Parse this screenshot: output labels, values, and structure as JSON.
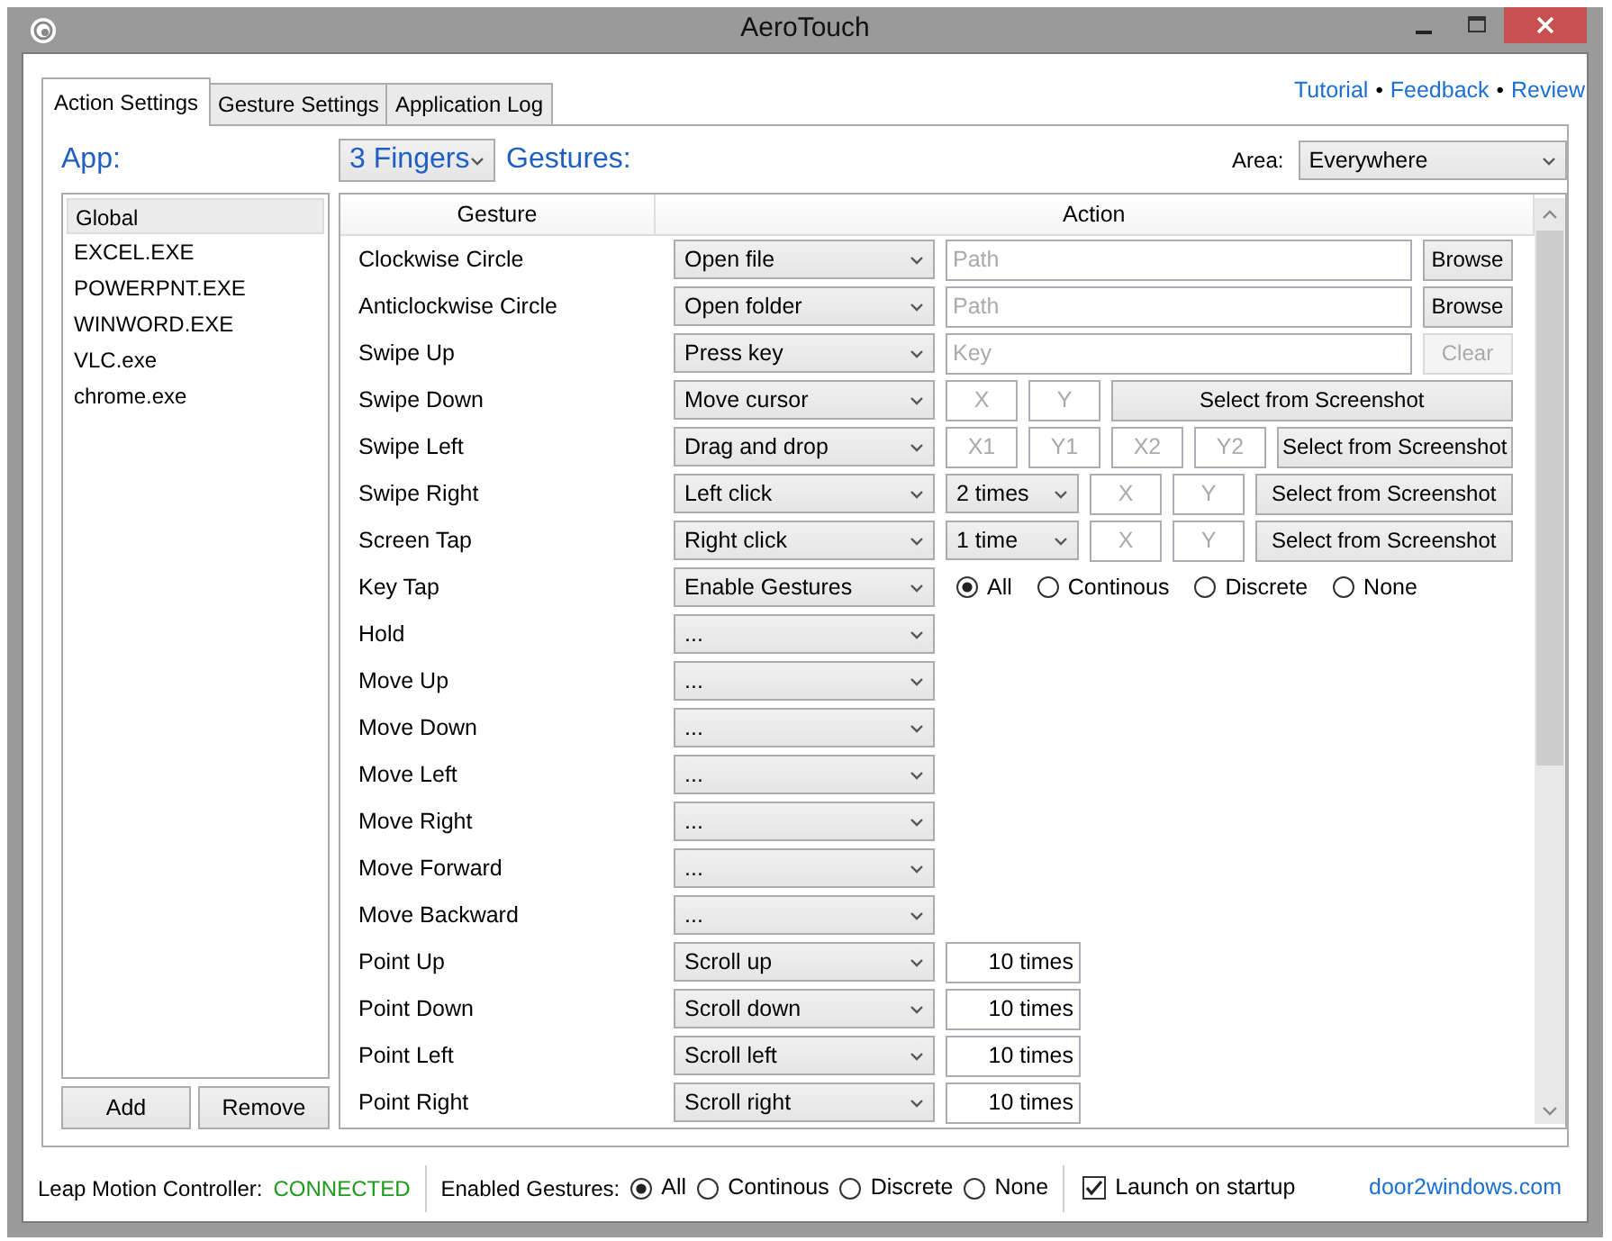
{
  "window": {
    "title": "AeroTouch"
  },
  "tabs": [
    {
      "label": "Action Settings",
      "selected": true
    },
    {
      "label": "Gesture Settings",
      "selected": false
    },
    {
      "label": "Application Log",
      "selected": false
    }
  ],
  "top_links": [
    {
      "kind": "link",
      "text": "Tutorial"
    },
    {
      "kind": "dot",
      "text": "•"
    },
    {
      "kind": "link",
      "text": "Feedback"
    },
    {
      "kind": "dot",
      "text": "•"
    },
    {
      "kind": "link",
      "text": "Review"
    }
  ],
  "app_panel": {
    "label": "App:",
    "apps": [
      {
        "name": "Global",
        "selected": true
      },
      {
        "name": "EXCEL.EXE",
        "selected": false
      },
      {
        "name": "POWERPNT.EXE",
        "selected": false
      },
      {
        "name": "WINWORD.EXE",
        "selected": false
      },
      {
        "name": "VLC.exe",
        "selected": false
      },
      {
        "name": "chrome.exe",
        "selected": false
      }
    ],
    "buttons": [
      "Add",
      "Remove"
    ]
  },
  "fingers": {
    "value": "3 Fingers"
  },
  "gestures_label": "Gestures:",
  "area": {
    "label": "Area:",
    "value": "Everywhere"
  },
  "table": {
    "columns": [
      "Gesture",
      "Action"
    ],
    "rows": [
      {
        "gesture": "Clockwise Circle",
        "action": "Open file",
        "kind": "path",
        "placeholder": "Path",
        "button": {
          "label": "Browse",
          "disabled": false
        }
      },
      {
        "gesture": "Anticlockwise Circle",
        "action": "Open folder",
        "kind": "path",
        "placeholder": "Path",
        "button": {
          "label": "Browse",
          "disabled": false
        }
      },
      {
        "gesture": "Swipe Up",
        "action": "Press key",
        "kind": "path",
        "placeholder": "Key",
        "button": {
          "label": "Clear",
          "disabled": true
        }
      },
      {
        "gesture": "Swipe Down",
        "action": "Move cursor",
        "kind": "point",
        "placeholders": [
          "X",
          "Y"
        ],
        "button": {
          "label": "Select from Screenshot",
          "disabled": false
        }
      },
      {
        "gesture": "Swipe Left",
        "action": "Drag and drop",
        "kind": "point",
        "placeholders": [
          "X1",
          "Y1",
          "X2",
          "Y2"
        ],
        "button": {
          "label": "Select from Screenshot",
          "disabled": false
        }
      },
      {
        "gesture": "Swipe Right",
        "action": "Left click",
        "kind": "point",
        "count": "2 times",
        "placeholders": [
          "X",
          "Y"
        ],
        "button": {
          "label": "Select from Screenshot",
          "disabled": false
        }
      },
      {
        "gesture": "Screen Tap",
        "action": "Right click",
        "kind": "point",
        "count": "1 time",
        "placeholders": [
          "X",
          "Y"
        ],
        "button": {
          "label": "Select from Screenshot",
          "disabled": false
        }
      },
      {
        "gesture": "Key Tap",
        "action": "Enable Gestures",
        "kind": "radios",
        "options": [
          {
            "label": "All",
            "selected": true
          },
          {
            "label": "Continous",
            "selected": false
          },
          {
            "label": "Discrete",
            "selected": false
          },
          {
            "label": "None",
            "selected": false
          }
        ]
      },
      {
        "gesture": "Hold",
        "action": "...",
        "kind": "plain"
      },
      {
        "gesture": "Move Up",
        "action": "...",
        "kind": "plain"
      },
      {
        "gesture": "Move Down",
        "action": "...",
        "kind": "plain"
      },
      {
        "gesture": "Move Left",
        "action": "...",
        "kind": "plain"
      },
      {
        "gesture": "Move Right",
        "action": "...",
        "kind": "plain"
      },
      {
        "gesture": "Move Forward",
        "action": "...",
        "kind": "plain"
      },
      {
        "gesture": "Move Backward",
        "action": "...",
        "kind": "plain"
      },
      {
        "gesture": "Point Up",
        "action": "Scroll up",
        "kind": "times",
        "value": "10 times"
      },
      {
        "gesture": "Point Down",
        "action": "Scroll down",
        "kind": "times",
        "value": "10 times"
      },
      {
        "gesture": "Point Left",
        "action": "Scroll left",
        "kind": "times",
        "value": "10 times"
      },
      {
        "gesture": "Point Right",
        "action": "Scroll right",
        "kind": "times",
        "value": "10 times"
      }
    ]
  },
  "status_bar": {
    "controller_label": "Leap Motion Controller:",
    "controller_state": "CONNECTED",
    "enabled_label": "Enabled Gestures:",
    "options": [
      {
        "label": "All",
        "selected": true
      },
      {
        "label": "Continous",
        "selected": false
      },
      {
        "label": "Discrete",
        "selected": false
      },
      {
        "label": "None",
        "selected": false
      }
    ],
    "launch": {
      "label": "Launch on startup",
      "checked": true
    },
    "site": "door2windows.com"
  }
}
